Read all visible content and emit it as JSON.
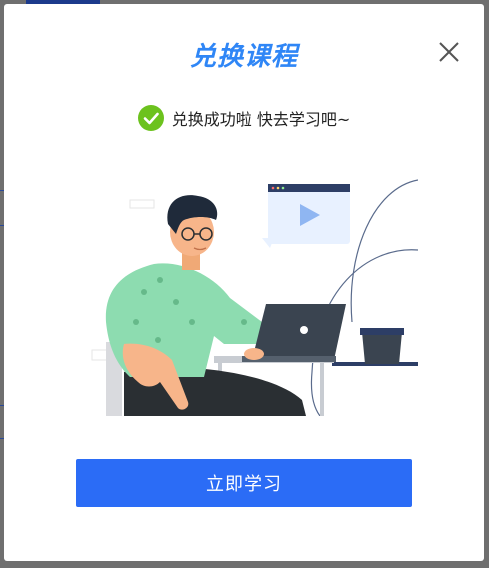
{
  "modal": {
    "title": "兑换课程",
    "status_text": "兑换成功啦 快去学习吧~",
    "primary_button_label": "立即学习",
    "icons": {
      "close": "close-icon",
      "success": "check-circle-icon",
      "illustration": "person-with-laptop-illustration"
    },
    "colors": {
      "title": "#2f86f6",
      "success": "#6cc21e",
      "button": "#2b6cf6"
    }
  }
}
